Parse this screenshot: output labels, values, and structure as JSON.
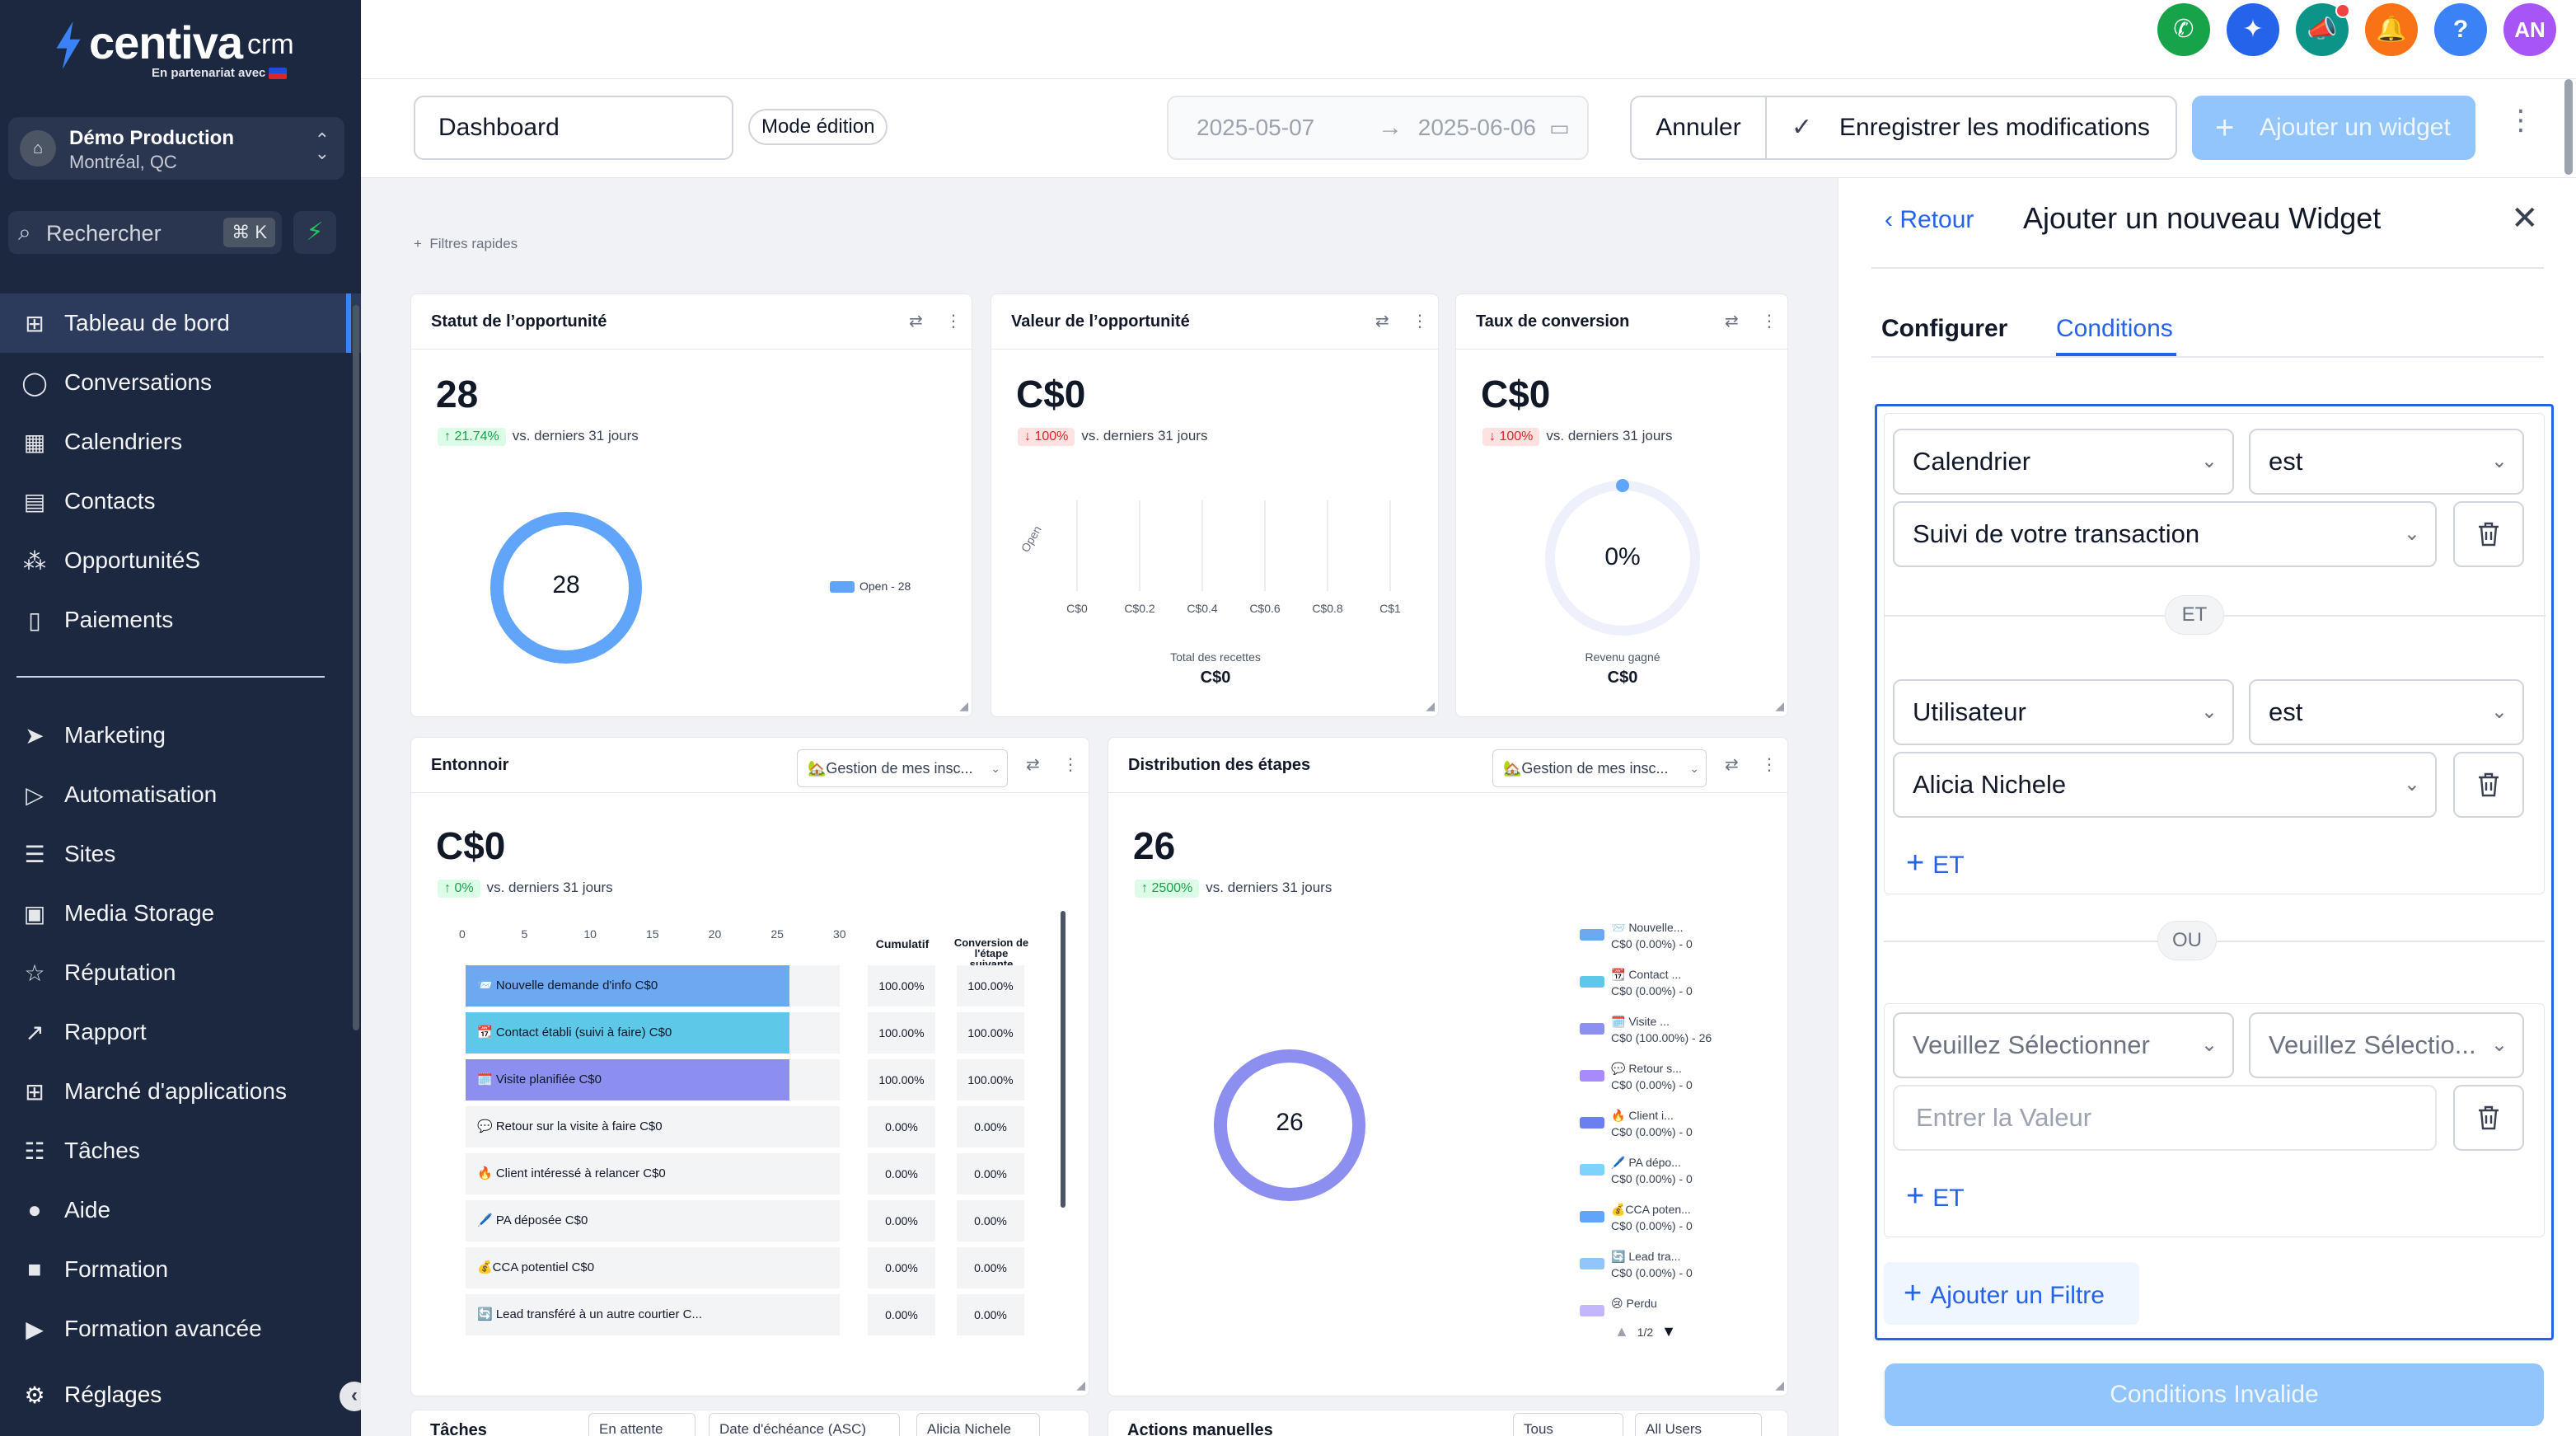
{
  "brand": {
    "name": "centiva",
    "suffix": "crm",
    "tagline": "En partenariat avec"
  },
  "account": {
    "name": "Démo Production",
    "location": "Montréal, QC"
  },
  "search": {
    "placeholder": "Rechercher",
    "shortcut": "⌘ K"
  },
  "nav": {
    "primary": [
      {
        "label": "Tableau de bord",
        "icon": "grid-icon",
        "active": true
      },
      {
        "label": "Conversations",
        "icon": "chat-icon"
      },
      {
        "label": "Calendriers",
        "icon": "calendar-icon"
      },
      {
        "label": "Contacts",
        "icon": "contacts-icon"
      },
      {
        "label": "OpportunitéS",
        "icon": "opportunities-icon"
      },
      {
        "label": "Paiements",
        "icon": "payments-icon"
      }
    ],
    "secondary": [
      {
        "label": "Marketing",
        "icon": "send-icon"
      },
      {
        "label": "Automatisation",
        "icon": "automation-icon"
      },
      {
        "label": "Sites",
        "icon": "sites-icon"
      },
      {
        "label": "Media Storage",
        "icon": "image-icon"
      },
      {
        "label": "Réputation",
        "icon": "star-icon"
      },
      {
        "label": "Rapport",
        "icon": "chart-icon"
      },
      {
        "label": "Marché d'applications",
        "icon": "apps-icon"
      },
      {
        "label": "Tâches",
        "icon": "tasks-icon"
      },
      {
        "label": "Aide",
        "icon": "help-icon"
      },
      {
        "label": "Formation",
        "icon": "video-icon"
      },
      {
        "label": "Formation avancée",
        "icon": "youtube-icon"
      }
    ],
    "settings": "Réglages"
  },
  "topbar": {
    "avatar_initials": "AN",
    "colors": {
      "phone": "#16a34a",
      "magic": "#2563eb",
      "announce": "#0d9488",
      "bell": "#f97316",
      "help": "#3b82f6",
      "avatar": "#a855f7"
    }
  },
  "actionbar": {
    "dashboard_name": "Dashboard",
    "mode": "Mode édition",
    "date_start": "2025-05-07",
    "date_end": "2025-06-06",
    "cancel": "Annuler",
    "save": "Enregistrer les modifications",
    "add_widget": "Ajouter un widget"
  },
  "canvas": {
    "quick_filters": "Filtres rapides",
    "opportunity_status": {
      "title": "Statut de l’opportunité",
      "value": "28",
      "delta": "21.74%",
      "delta_suffix": "vs. derniers 31 jours",
      "donut_center": "28",
      "legend": "Open - 28"
    },
    "opportunity_value": {
      "title": "Valeur de l’opportunité",
      "value": "C$0",
      "delta": "100%",
      "delta_suffix": "vs. derniers 31 jours",
      "y_category": "Open",
      "x_ticks": [
        "C$0",
        "C$0.2",
        "C$0.4",
        "C$0.6",
        "C$0.8",
        "C$1"
      ],
      "total_label": "Total des recettes",
      "total_value": "C$0"
    },
    "conversion_rate": {
      "title": "Taux de conversion",
      "value": "C$0",
      "delta": "100%",
      "delta_suffix": "vs. derniers 31 jours",
      "gauge_value": "0%",
      "revenue_label": "Revenu gagné",
      "revenue_value": "C$0"
    },
    "funnel": {
      "title": "Entonnoir",
      "pipeline": "🏡Gestion de mes insc...",
      "value": "C$0",
      "delta": "0%",
      "delta_suffix": "vs. derniers 31 jours",
      "axis": [
        "0",
        "5",
        "10",
        "15",
        "20",
        "25",
        "30"
      ],
      "col_cumulative": "Cumulatif",
      "col_conversion": "Conversion de l'étape suivante",
      "rows": [
        {
          "label": "📨 Nouvelle demande d'info   C$0",
          "count": 26,
          "color": "#6ea8f0",
          "cumulative": "100.00%",
          "conversion": "100.00%"
        },
        {
          "label": "📆 Contact établi (suivi à faire)   C$0",
          "count": 26,
          "color": "#5ec8e8",
          "cumulative": "100.00%",
          "conversion": "100.00%"
        },
        {
          "label": "🗓️ Visite planifiée   C$0",
          "count": 26,
          "color": "#8c8ef0",
          "cumulative": "100.00%",
          "conversion": "100.00%"
        },
        {
          "label": "💬 Retour sur la visite à faire   C$0",
          "count": 0,
          "color": "#8c8ef0",
          "cumulative": "0.00%",
          "conversion": "0.00%"
        },
        {
          "label": "🔥 Client intéressé à relancer   C$0",
          "count": 0,
          "color": "#8c8ef0",
          "cumulative": "0.00%",
          "conversion": "0.00%"
        },
        {
          "label": "🖊️ PA déposée   C$0",
          "count": 0,
          "color": "#8c8ef0",
          "cumulative": "0.00%",
          "conversion": "0.00%"
        },
        {
          "label": "💰CCA potentiel   C$0",
          "count": 0,
          "color": "#8c8ef0",
          "cumulative": "0.00%",
          "conversion": "0.00%"
        },
        {
          "label": "🔄 Lead transféré à un autre courtier   C...",
          "count": 0,
          "color": "#8c8ef0",
          "cumulative": "0.00%",
          "conversion": "0.00%"
        }
      ]
    },
    "stage_distribution": {
      "title": "Distribution des étapes",
      "pipeline": "🏡Gestion de mes insc...",
      "value": "26",
      "delta": "2500%",
      "delta_suffix": "vs. derniers 31 jours",
      "donut_center": "26",
      "legend": [
        {
          "name": "📨 Nouvelle...",
          "detail": "C$0 (0.00%) - 0",
          "color": "#6ea8f0"
        },
        {
          "name": "📆 Contact ...",
          "detail": "C$0 (0.00%) - 0",
          "color": "#5ec8e8"
        },
        {
          "name": "🗓️ Visite ...",
          "detail": "C$0 (100.00%) - 26",
          "color": "#8c8ef0"
        },
        {
          "name": "💬 Retour s...",
          "detail": "C$0 (0.00%) - 0",
          "color": "#a78bfa"
        },
        {
          "name": "🔥 Client i...",
          "detail": "C$0 (0.00%) - 0",
          "color": "#6b7ff0"
        },
        {
          "name": "🖊️ PA dépo...",
          "detail": "C$0 (0.00%) - 0",
          "color": "#7dd3fc"
        },
        {
          "name": "💰CCA poten...",
          "detail": "C$0 (0.00%) - 0",
          "color": "#60a5fa"
        },
        {
          "name": "🔄 Lead tra...",
          "detail": "C$0 (0.00%) - 0",
          "color": "#93c5fd"
        },
        {
          "name": "😢 Perdu",
          "detail": "",
          "color": "#c4b5fd"
        }
      ],
      "pager": "1/2"
    },
    "tasks": {
      "title": "Tâches",
      "status": "En attente",
      "sort": "Date d'échéance (ASC)",
      "user": "Alicia Nichele"
    },
    "manual_actions": {
      "title": "Actions manuelles",
      "filter": "Tous",
      "users": "All Users"
    }
  },
  "panel": {
    "back": "Retour",
    "title": "Ajouter un nouveau Widget",
    "tabs": {
      "configure": "Configurer",
      "conditions": "Conditions"
    },
    "group1": {
      "field": "Calendrier",
      "operator": "est",
      "value": "Suivi de votre transaction",
      "and_label": "ET",
      "field2": "Utilisateur",
      "operator2": "est",
      "value2": "Alicia Nichele",
      "add_and": "ET"
    },
    "or_label": "OU",
    "group2": {
      "field_placeholder": "Veuillez Sélectionner",
      "operator_placeholder": "Veuillez Sélectio...",
      "value_placeholder": "Entrer la Valeur",
      "add_and": "ET"
    },
    "add_filter": "Ajouter un Filtre",
    "submit": "Conditions Invalide"
  }
}
